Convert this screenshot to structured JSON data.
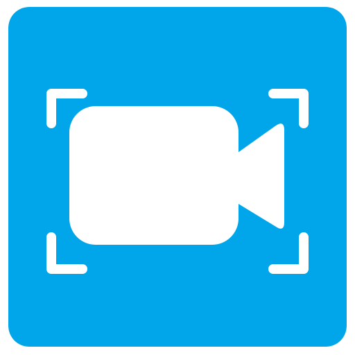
{
  "app_icon": {
    "icon": "video-camera-icon",
    "frame_icon": "viewfinder-corners-icon",
    "colors": {
      "background": "#00A6E9",
      "foreground": "#FFFFFF"
    }
  }
}
